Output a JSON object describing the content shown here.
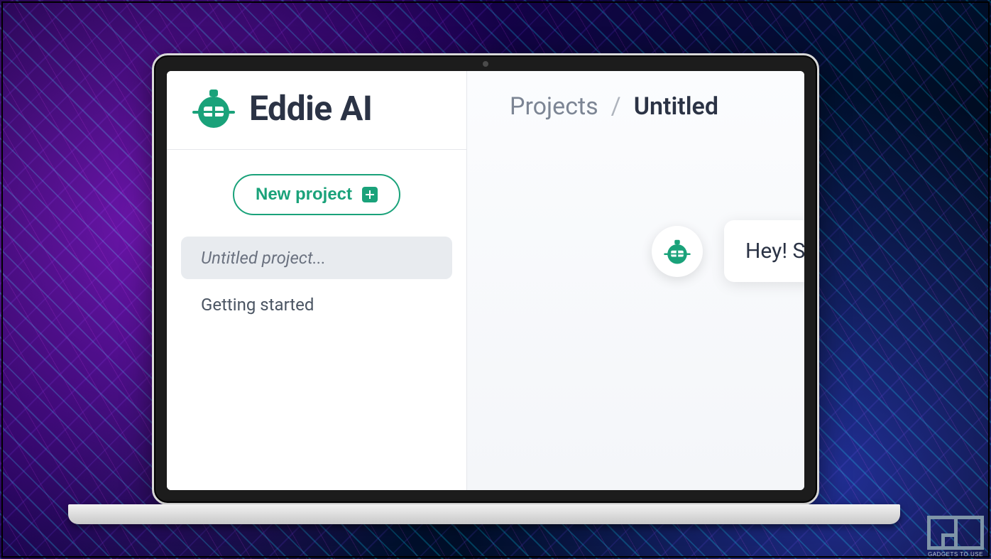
{
  "app": {
    "name": "Eddie AI",
    "logo_color": "#1aa27a"
  },
  "sidebar": {
    "new_project_label": "New project",
    "projects": [
      {
        "label": "Untitled project...",
        "active": true
      },
      {
        "label": "Getting started",
        "active": false
      }
    ]
  },
  "breadcrumb": {
    "root": "Projects",
    "separator": "/",
    "current": "Untitled"
  },
  "chat": {
    "greeting": "Hey! S"
  },
  "watermark": {
    "label": "GADGETS TO USE"
  }
}
